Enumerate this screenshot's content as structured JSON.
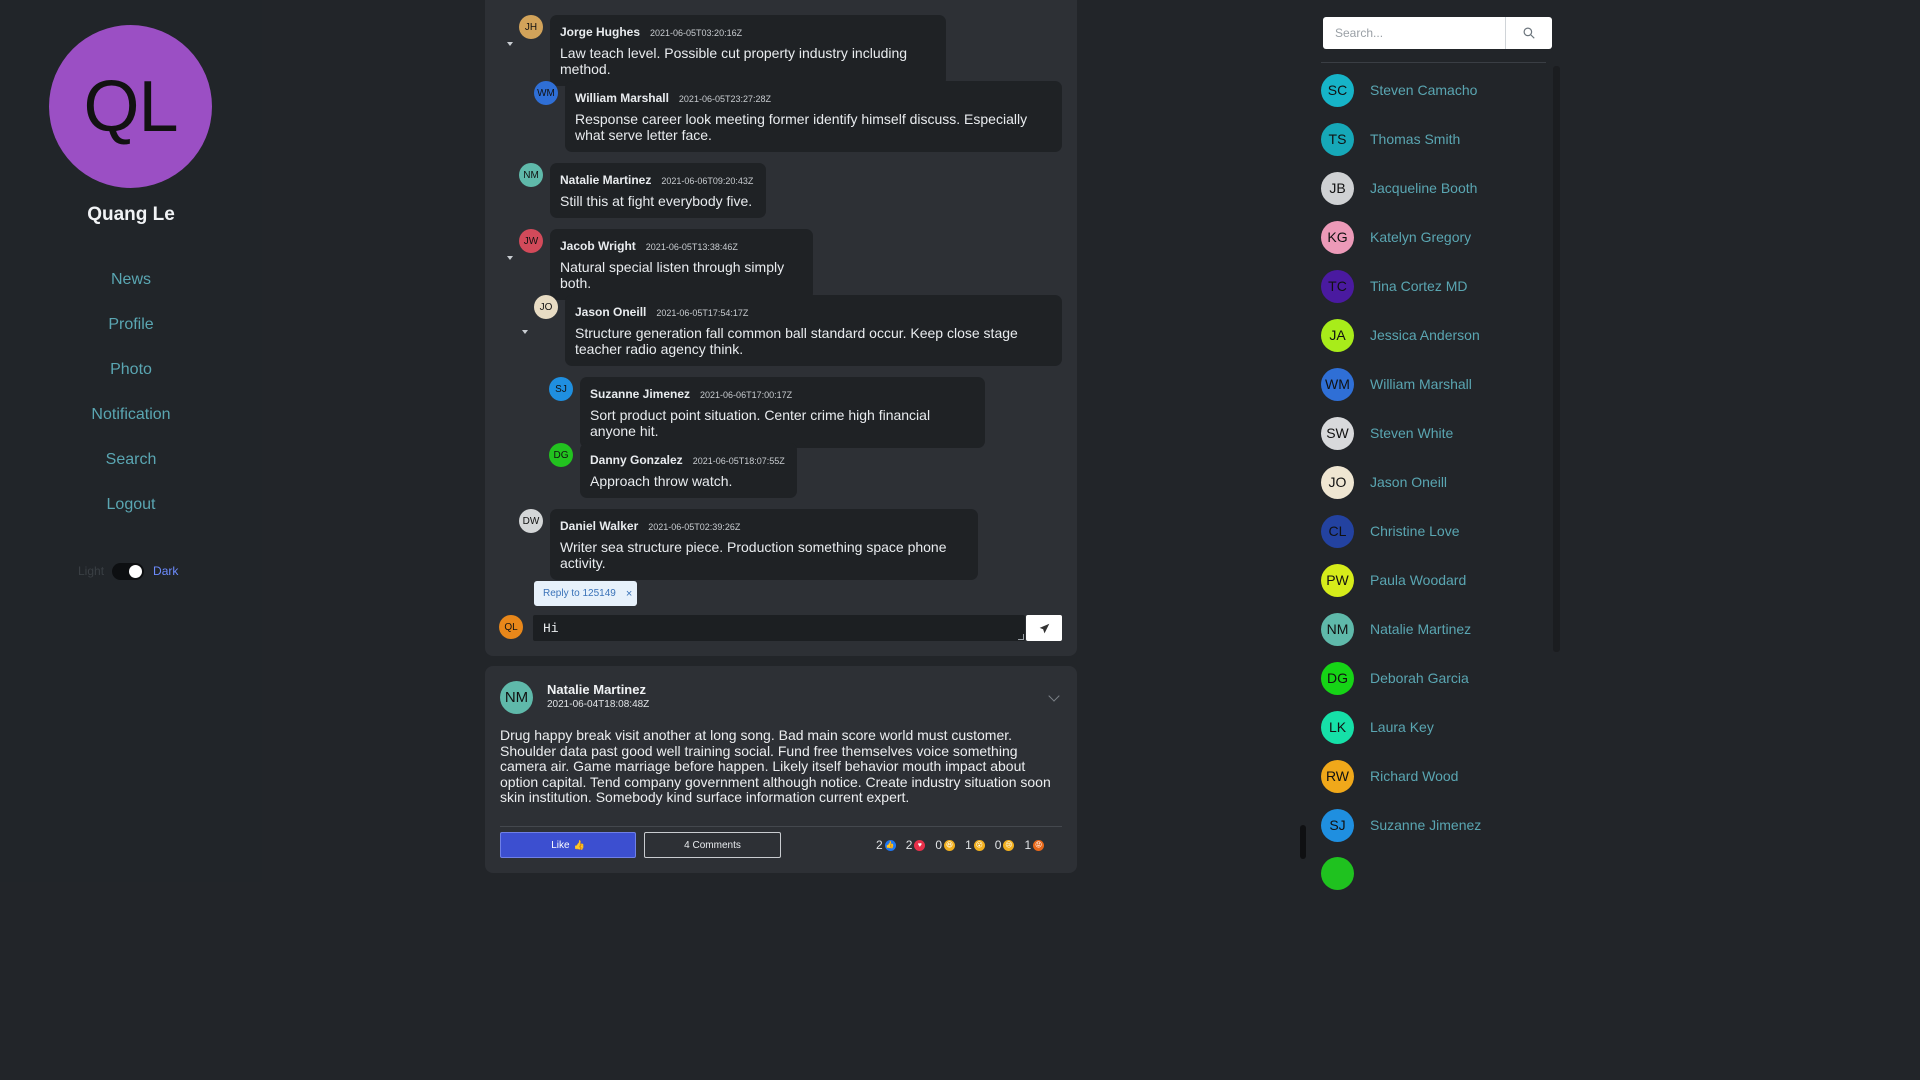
{
  "profile": {
    "initials": "QL",
    "name": "Quang Le",
    "avatar_color": "#9b4fc4"
  },
  "nav": [
    "News",
    "Profile",
    "Photo",
    "Notification",
    "Search",
    "Logout"
  ],
  "theme": {
    "light_label": "Light",
    "dark_label": "Dark",
    "active": "dark"
  },
  "comments": [
    {
      "initials": "JH",
      "name": "Jorge Hughes",
      "time": "2021-06-05T03:20:16Z",
      "text": "Law teach level. Possible cut property industry including method.",
      "avatar_color": "#d2a35a",
      "depth": 0,
      "has_replies": true
    },
    {
      "initials": "WM",
      "name": "William Marshall",
      "time": "2021-06-05T23:27:28Z",
      "text": "Response career look meeting former identify himself discuss. Especially what serve letter face.",
      "avatar_color": "#2f6fd6",
      "depth": 1,
      "has_replies": false
    },
    {
      "initials": "NM",
      "name": "Natalie Martinez",
      "time": "2021-06-06T09:20:43Z",
      "text": "Still this at fight everybody five.",
      "avatar_color": "#5fb9aa",
      "depth": 0,
      "has_replies": false
    },
    {
      "initials": "JW",
      "name": "Jacob Wright",
      "time": "2021-06-05T13:38:46Z",
      "text": "Natural special listen through simply both.",
      "avatar_color": "#d24a5a",
      "depth": 0,
      "has_replies": true
    },
    {
      "initials": "JO",
      "name": "Jason Oneill",
      "time": "2021-06-05T17:54:17Z",
      "text": "Structure generation fall common ball standard occur. Keep close stage teacher radio agency think.",
      "avatar_color": "#e8dcc4",
      "depth": 1,
      "has_replies": true
    },
    {
      "initials": "SJ",
      "name": "Suzanne Jimenez",
      "time": "2021-06-06T17:00:17Z",
      "text": "Sort product point situation. Center crime high financial anyone hit.",
      "avatar_color": "#1f8fe0",
      "depth": 2,
      "has_replies": false
    },
    {
      "initials": "DG",
      "name": "Danny Gonzalez",
      "time": "2021-06-05T18:07:55Z",
      "text": "Approach throw watch.",
      "avatar_color": "#22c21f",
      "depth": 2,
      "has_replies": false
    },
    {
      "initials": "DW",
      "name": "Daniel Walker",
      "time": "2021-06-05T02:39:26Z",
      "text": "Writer sea structure piece. Production something space phone activity.",
      "avatar_color": "#d4d6d8",
      "depth": 0,
      "has_replies": false
    }
  ],
  "composer": {
    "reply_chip": "Reply to 125149",
    "value": "Hi",
    "user_initials": "QL",
    "user_color": "#e8871a"
  },
  "post": {
    "initials": "NM",
    "author": "Natalie Martinez",
    "time": "2021-06-04T18:08:48Z",
    "body": "Drug happy break visit another at long song. Bad main score world must customer. Shoulder data past good well training social. Fund free themselves voice something camera air. Game marriage before happen. Likely itself behavior mouth impact about option capital. Tend company government although notice. Create industry situation soon skin institution. Somebody kind surface information current expert.",
    "like_label": "Like",
    "comments_label": "4 Comments",
    "reactions": [
      {
        "count": "2",
        "icon": "thumbs-up-icon",
        "color": "#1f77f2"
      },
      {
        "count": "2",
        "icon": "heart-icon",
        "color": "#e8304a"
      },
      {
        "count": "0",
        "icon": "laugh-icon",
        "color": "#f2b01f"
      },
      {
        "count": "1",
        "icon": "wow-icon",
        "color": "#f2b01f"
      },
      {
        "count": "0",
        "icon": "sad-icon",
        "color": "#f2b01f"
      },
      {
        "count": "1",
        "icon": "angry-icon",
        "color": "#e8681a"
      }
    ]
  },
  "search": {
    "placeholder": "Search..."
  },
  "contacts": [
    {
      "initials": "SC",
      "name": "Steven Camacho",
      "color": "#16b4c8"
    },
    {
      "initials": "TS",
      "name": "Thomas Smith",
      "color": "#16a8b8"
    },
    {
      "initials": "JB",
      "name": "Jacqueline Booth",
      "color": "#cfd1d3"
    },
    {
      "initials": "KG",
      "name": "Katelyn Gregory",
      "color": "#ec9ab8"
    },
    {
      "initials": "TC",
      "name": "Tina Cortez MD",
      "color": "#4a1aa0"
    },
    {
      "initials": "JA",
      "name": "Jessica Anderson",
      "color": "#a8ec1a"
    },
    {
      "initials": "WM",
      "name": "William Marshall",
      "color": "#2f6fd6"
    },
    {
      "initials": "SW",
      "name": "Steven White",
      "color": "#d8d9db"
    },
    {
      "initials": "JO",
      "name": "Jason Oneill",
      "color": "#efe6d2"
    },
    {
      "initials": "CL",
      "name": "Christine Love",
      "color": "#2342a0"
    },
    {
      "initials": "PW",
      "name": "Paula Woodard",
      "color": "#d6ec1a"
    },
    {
      "initials": "NM",
      "name": "Natalie Martinez",
      "color": "#5fb9aa"
    },
    {
      "initials": "DG",
      "name": "Deborah Garcia",
      "color": "#16d416"
    },
    {
      "initials": "LK",
      "name": "Laura Key",
      "color": "#16e0a8"
    },
    {
      "initials": "RW",
      "name": "Richard Wood",
      "color": "#f0a81a"
    },
    {
      "initials": "SJ",
      "name": "Suzanne Jimenez",
      "color": "#1f8fe0"
    }
  ]
}
